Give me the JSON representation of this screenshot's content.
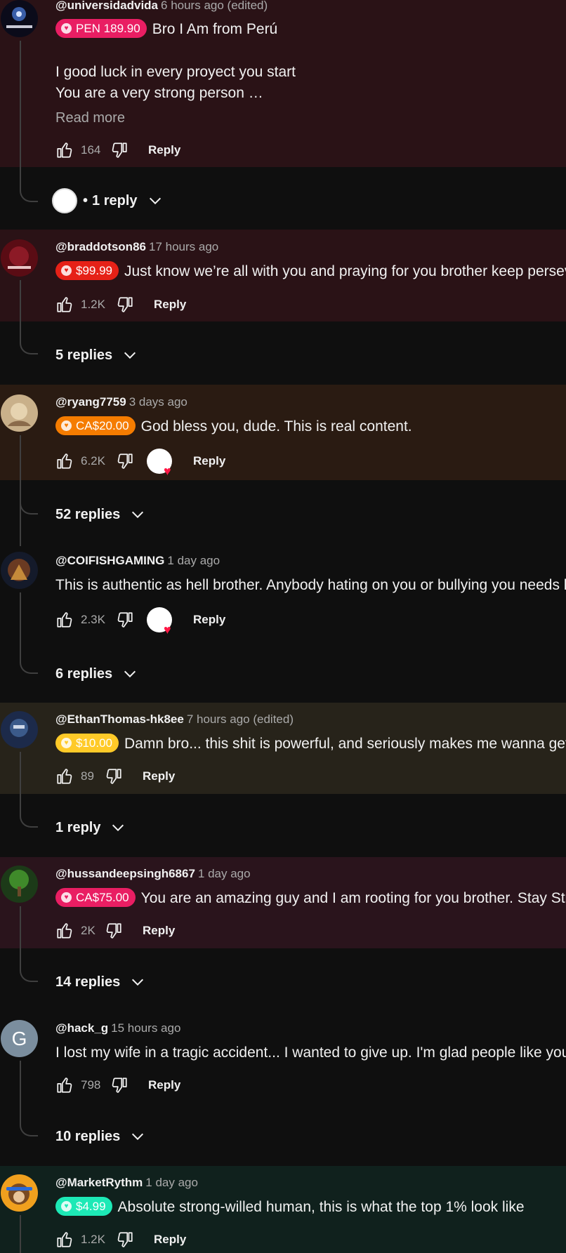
{
  "colors": {
    "page_bg": "#0f0f0f",
    "red_card": "#2a1216",
    "orange_card": "#2a1b12",
    "yellow_card": "#27231a",
    "magenta_card": "#2a141c",
    "teal_card": "#10211d",
    "badge_red": "#e62117",
    "badge_orange": "#f57c00",
    "badge_yellow": "#ffca28",
    "badge_magenta": "#e91e63",
    "badge_teal": "#1de9b6",
    "badge_pink": "#e91e63"
  },
  "icons": {
    "like": "thumb-up-icon",
    "dislike": "thumb-down-icon",
    "expand": "chevron-down-icon",
    "creator_heart": "heart-icon"
  },
  "comments": [
    {
      "handle": "@universidadvida",
      "time": "6 hours ago (edited)",
      "badge": "PEN 189.90",
      "lines": [
        "Bro I Am from Perú",
        "",
        "I good luck in every proyect you start",
        "You are a very strong person …"
      ],
      "read_more": "Read more",
      "likes": "164",
      "reply_label": "Reply",
      "replies": "1 reply",
      "reply_dot": "•"
    },
    {
      "handle": "@braddotson86",
      "time": "17 hours ago",
      "badge": "$99.99",
      "lines": [
        "Just know we’re all with you and praying for you brother keep persevering"
      ],
      "likes": "1.2K",
      "reply_label": "Reply",
      "replies": "5 replies"
    },
    {
      "handle": "@ryang7759",
      "time": "3 days ago",
      "badge": "CA$20.00",
      "lines": [
        "God bless you, dude. This is real content."
      ],
      "likes": "6.2K",
      "reply_label": "Reply",
      "replies": "52 replies"
    },
    {
      "handle": "@COIFISHGAMING",
      "time": "1 day ago",
      "lines": [
        "This is authentic as hell brother. Anybody hating on you or bullying you needs help"
      ],
      "likes": "2.3K",
      "reply_label": "Reply",
      "replies": "6 replies"
    },
    {
      "handle": "@EthanThomas-hk8ee",
      "time": "7 hours ago (edited)",
      "badge": "$10.00",
      "lines": [
        "Damn bro... this shit is powerful, and seriously makes me wanna get better"
      ],
      "likes": "89",
      "reply_label": "Reply",
      "replies": "1 reply"
    },
    {
      "handle": "@hussandeepsingh6867",
      "time": "1 day ago",
      "badge": "CA$75.00",
      "lines": [
        "You are an amazing guy and I am rooting for you brother. Stay Strong"
      ],
      "likes": "2K",
      "reply_label": "Reply",
      "replies": "14 replies"
    },
    {
      "handle": "@hack_g",
      "time": "15 hours ago",
      "avatar_letter": "G",
      "lines": [
        "I lost my wife in a tragic accident... I wanted to give up. I'm glad people like you exist"
      ],
      "likes": "798",
      "reply_label": "Reply",
      "replies": "10 replies"
    },
    {
      "handle": "@MarketRythm",
      "time": "1 day ago",
      "badge": "$4.99",
      "lines": [
        "Absolute strong-willed human, this is what the top 1% look like"
      ],
      "likes": "1.2K",
      "reply_label": "Reply"
    }
  ]
}
